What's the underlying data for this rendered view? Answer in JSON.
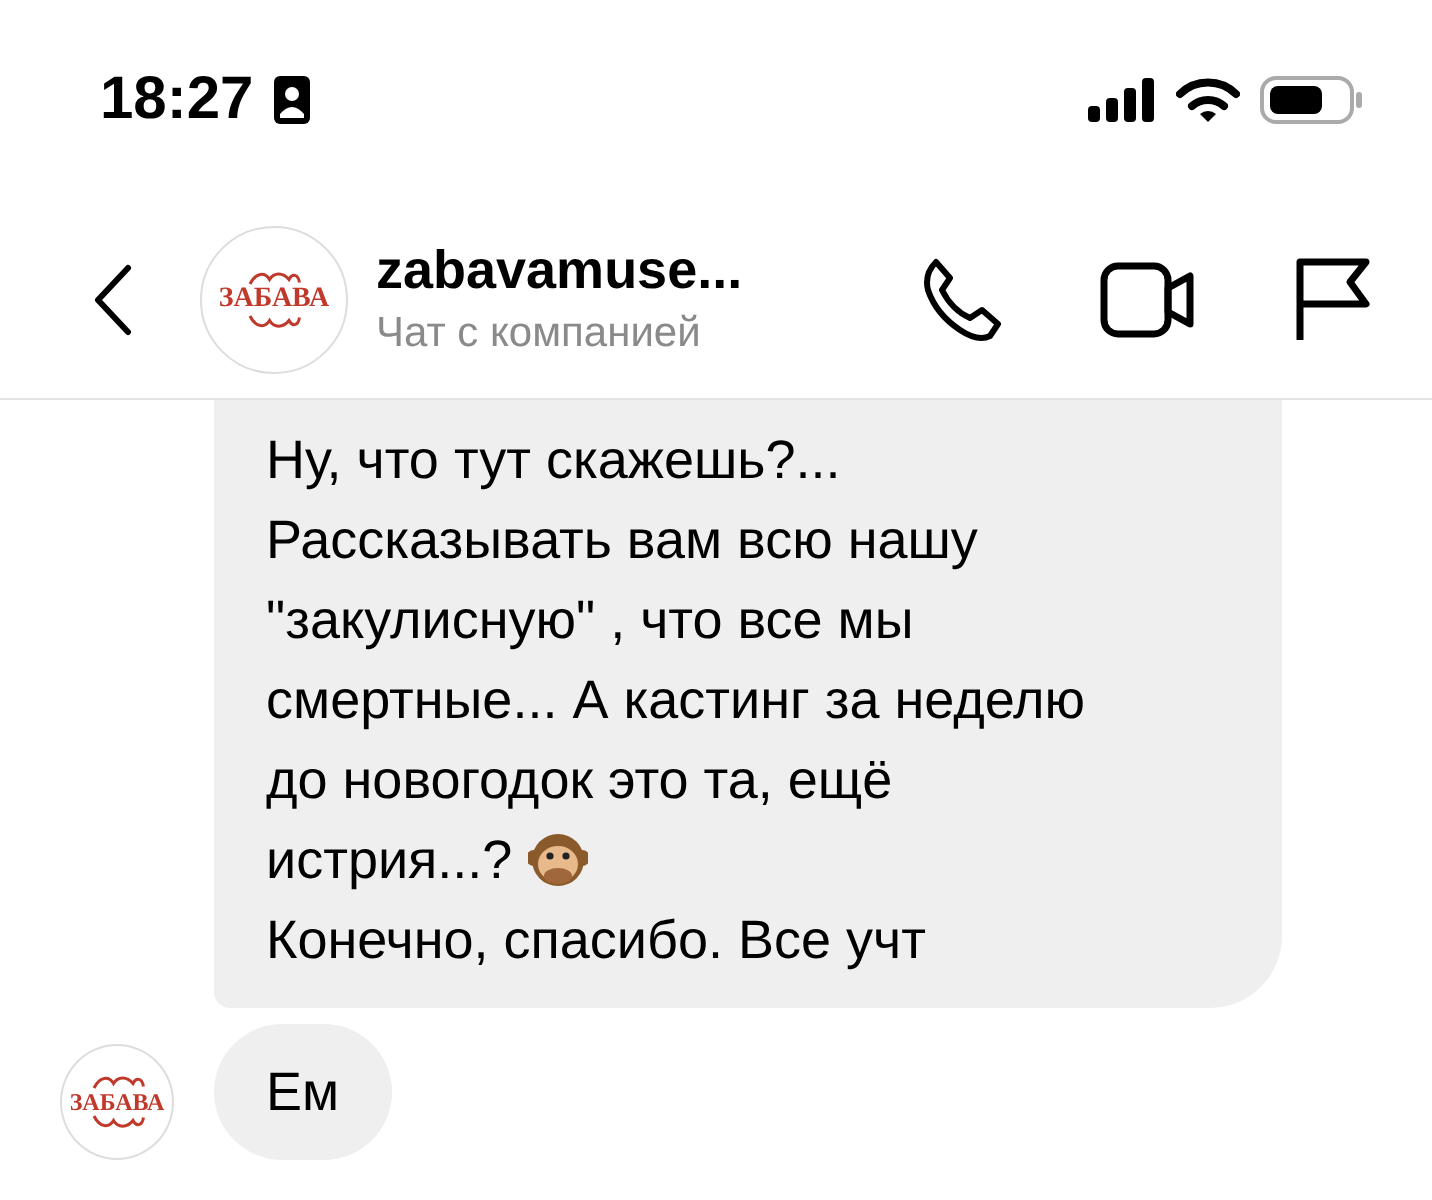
{
  "status_bar": {
    "time": "18:27"
  },
  "header": {
    "avatar_text": "ЗАБАВА",
    "name": "zabavamuse...",
    "subtitle": "Чат с компанией"
  },
  "messages": [
    {
      "kind": "bubble_cut",
      "lines": [
        {
          "kind": "text",
          "text": "Ну, что тут скажешь?...\nРассказывать вам всю нашу\n\"закулисную\" , что все мы\nсмертные... А кастинг за неделю\nдо новогодок это та, ещё"
        },
        {
          "kind": "text_emoji",
          "text": "истрия...?"
        },
        {
          "kind": "text",
          "text": "Конечно, спасибо. Все учт"
        }
      ]
    },
    {
      "kind": "bubble",
      "avatar_text": "ЗАБАВА",
      "lines": [
        {
          "kind": "text",
          "text": "Ем"
        }
      ]
    }
  ]
}
